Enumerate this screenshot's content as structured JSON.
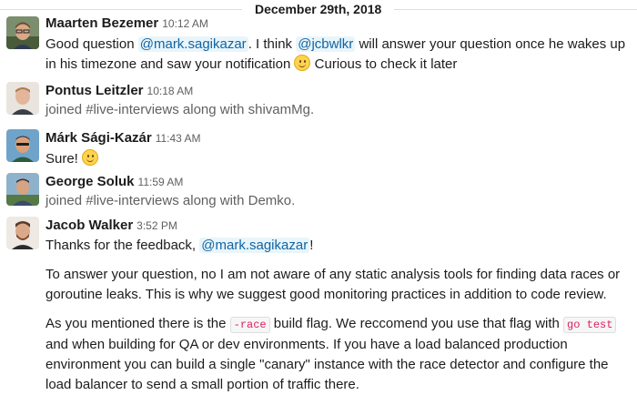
{
  "day_divider": "December 29th, 2018",
  "messages": [
    {
      "author": "Maarten Bezemer",
      "time": "10:12 AM",
      "parts": [
        "Good question ",
        "@mark.sagikazar",
        ". I think ",
        "@jcbwlkr",
        " will answer your question once he wakes up in his timezone and saw your notification ",
        " Curious to check it later"
      ],
      "emoji": "slightly-smiling-face"
    },
    {
      "author": "Pontus Leitzler",
      "time": "10:18 AM",
      "text": "joined #live-interviews along with shivamMg."
    },
    {
      "author": "Márk Sági-Kazár",
      "time": "11:43 AM",
      "text": "Sure!",
      "emoji": "slightly-smiling-face"
    },
    {
      "author": "George Soluk",
      "time": "11:59 AM",
      "text": "joined #live-interviews along with Demko."
    },
    {
      "author": "Jacob Walker",
      "time": "3:52 PM",
      "line1": [
        "Thanks for the feedback, ",
        "@mark.sagikazar",
        "!"
      ],
      "para2": "To answer your question, no I am not aware of any static analysis tools for finding data races or goroutine leaks. This is why we suggest good monitoring practices in addition to code review.",
      "para3": [
        "As you mentioned there is the ",
        "-race",
        " build flag. We reccomend you use that flag with ",
        "go test",
        " and when building for QA or dev environments. If you have a load balanced production environment you can build a single \"canary\" instance with the race detector and configure the load balancer to send a small portion of traffic there."
      ]
    }
  ]
}
